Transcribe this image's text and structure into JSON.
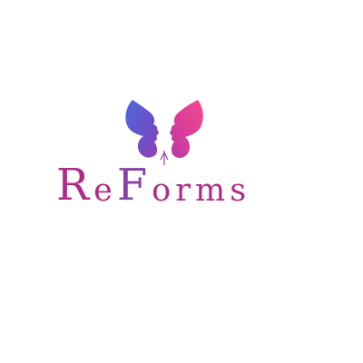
{
  "logo": {
    "letters": [
      "R",
      "e",
      "F",
      "o",
      "r",
      "m",
      "s"
    ],
    "wordmark_color": "#b02a8a",
    "gradient": {
      "left": "#4a5bd0",
      "right": "#e23a8e"
    }
  }
}
